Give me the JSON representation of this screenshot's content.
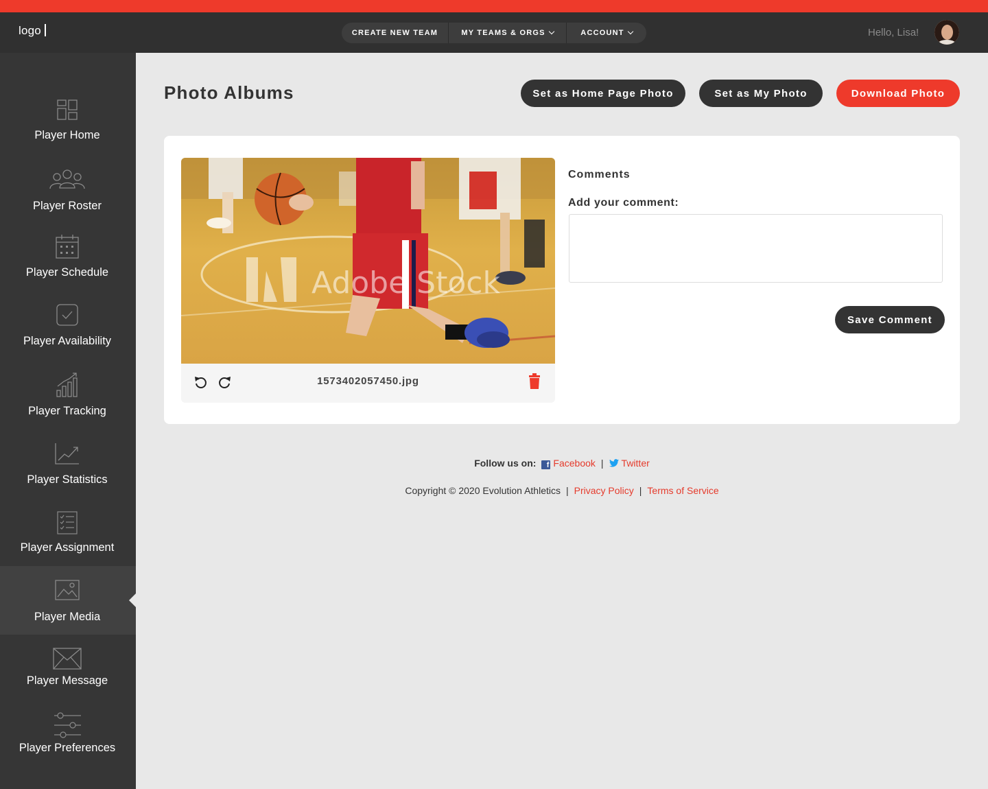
{
  "header": {
    "logo": "logo",
    "nav": [
      "CREATE NEW TEAM",
      "MY TEAMS & ORGS",
      "ACCOUNT"
    ],
    "greeting": "Hello, Lisa!"
  },
  "sidebar": {
    "items": [
      {
        "label": "Player Home",
        "icon": "dashboard-icon"
      },
      {
        "label": "Player Roster",
        "icon": "group-icon"
      },
      {
        "label": "Player Schedule",
        "icon": "calendar-icon"
      },
      {
        "label": "Player Availability",
        "icon": "check-square-icon"
      },
      {
        "label": "Player Tracking",
        "icon": "bar-chart-icon"
      },
      {
        "label": "Player Statistics",
        "icon": "trend-icon"
      },
      {
        "label": "Player Assignment",
        "icon": "checklist-icon"
      },
      {
        "label": "Player Media",
        "icon": "image-icon",
        "active": true
      },
      {
        "label": "Player Message",
        "icon": "envelope-icon"
      },
      {
        "label": "Player Preferences",
        "icon": "sliders-icon"
      }
    ]
  },
  "page": {
    "title": "Photo Albums",
    "buttons": {
      "home_photo": "Set as Home Page Photo",
      "my_photo": "Set as My Photo",
      "download": "Download Photo"
    }
  },
  "photo": {
    "filename": "1573402057450.jpg",
    "watermark": "Adobe Stock"
  },
  "comments": {
    "title": "Comments",
    "add_label": "Add your comment:",
    "value": "",
    "save_label": "Save Comment"
  },
  "footer": {
    "follow_label": "Follow us on:",
    "facebook": "Facebook",
    "twitter": "Twitter",
    "copyright": "Copyright © 2020 Evolution Athletics",
    "privacy": "Privacy Policy",
    "terms": "Terms of Service"
  },
  "colors": {
    "accent": "#ee3a2b",
    "dark": "#333333",
    "sidebar": "#363636",
    "background": "#e8e8e8"
  }
}
